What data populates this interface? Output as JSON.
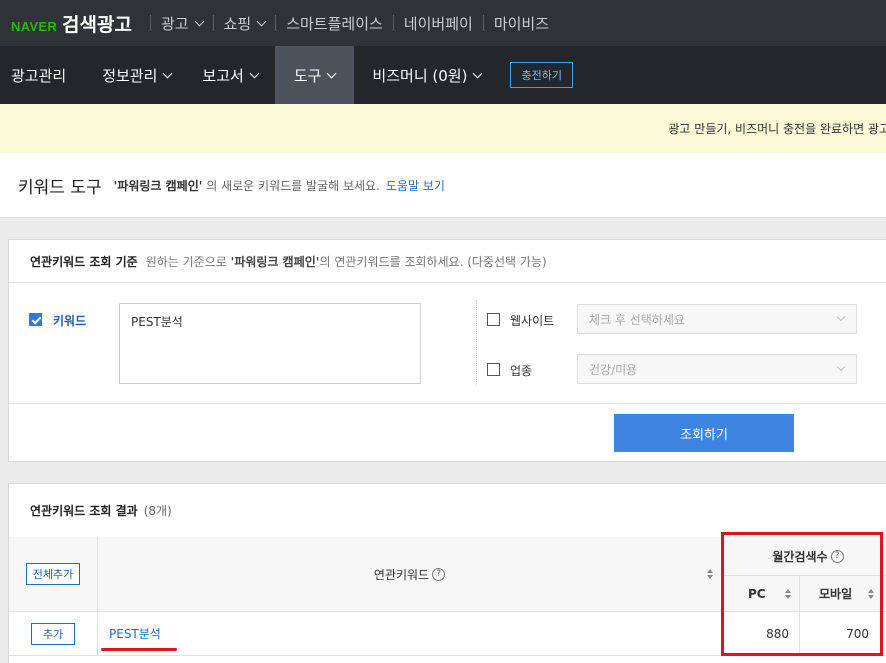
{
  "topbar": {
    "brand_logo": "NAVER",
    "brand_title": "검색광고",
    "items": [
      {
        "label": "광고",
        "dropdown": true
      },
      {
        "label": "쇼핑",
        "dropdown": true
      },
      {
        "label": "스마트플레이스",
        "dropdown": false
      },
      {
        "label": "네이버페이",
        "dropdown": false
      },
      {
        "label": "마이비즈",
        "dropdown": false
      }
    ]
  },
  "navbar": {
    "items": [
      {
        "label": "광고관리"
      },
      {
        "label": "정보관리"
      },
      {
        "label": "보고서"
      },
      {
        "label": "도구"
      },
      {
        "label": "비즈머니 (0원)"
      }
    ],
    "active": "도구",
    "charge_button": "충전하기"
  },
  "notice": {
    "text": "광고 만들기, 비즈머니 충전을 완료하면 광고"
  },
  "header": {
    "title": "키워드 도구",
    "sub_campaign": "'파워링크 캠페인'",
    "sub_text": "의 새로운 키워드를 발굴해 보세요.",
    "help_link": "도움말 보기"
  },
  "criteria": {
    "title": "연관키워드 조회 기준",
    "desc_prefix": "원하는 기준으로",
    "desc_campaign": "'파워링크 캠페인'",
    "desc_suffix": "의 연관키워드를 조회하세요. (다중선택 가능)",
    "keyword": {
      "label": "키워드",
      "checked": true,
      "value": "PEST분석"
    },
    "website": {
      "label": "웹사이트",
      "checked": false,
      "placeholder": "체크 후 선택하세요"
    },
    "industry": {
      "label": "업종",
      "checked": false,
      "selected": "건강/미용"
    },
    "search_button": "조회하기"
  },
  "results": {
    "title": "연관키워드 조회 결과",
    "count": "(8개)",
    "columns": {
      "add_all": "전체추가",
      "keyword": "연관키워드",
      "monthly": "월간검색수",
      "pc": "PC",
      "mobile": "모바일"
    },
    "rows": [
      {
        "add": "추가",
        "keyword": "PEST분석",
        "pc": "880",
        "mobile": "700"
      }
    ]
  },
  "colors": {
    "topbar_bg": "#2f3338",
    "navbar_bg": "#23272c",
    "navbar_active_bg": "#4b525c",
    "naver_green": "#2db400",
    "notice_bg": "#fbf8d6",
    "primary_button": "#3d85de",
    "link": "#1a6fc4",
    "annotation_red": "#e0141e"
  },
  "icons": [
    "chevron-down-icon",
    "checkbox-icon",
    "help-circle-icon",
    "sort-icon",
    "select-arrow-icon"
  ]
}
